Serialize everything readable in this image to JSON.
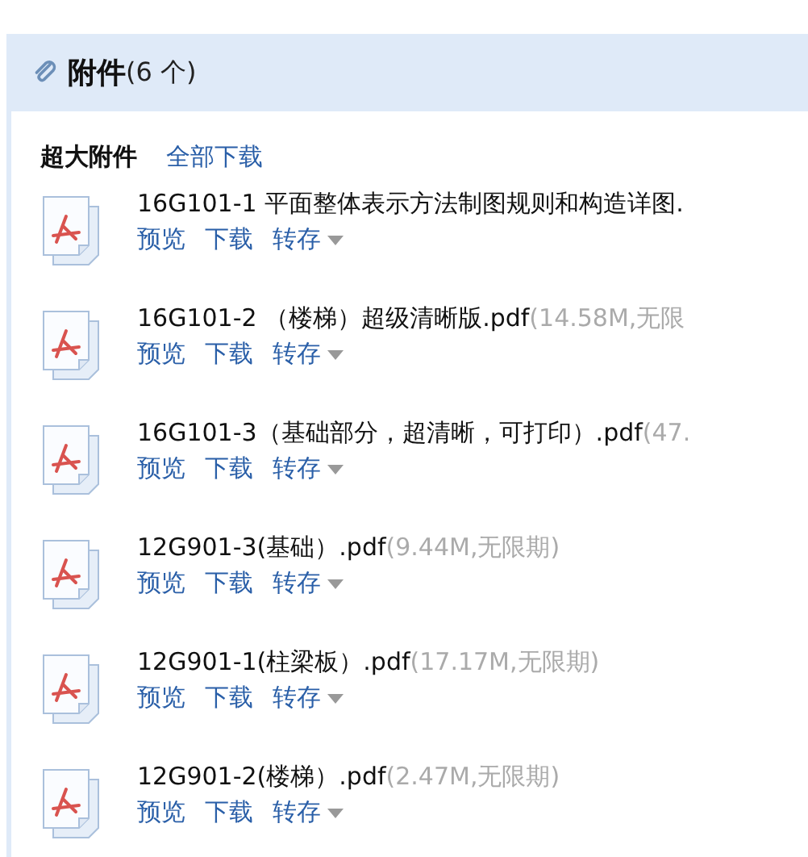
{
  "header": {
    "title": "附件",
    "count": "(6 个)"
  },
  "group": {
    "label": "超大附件",
    "download_all": "全部下载"
  },
  "files": [
    {
      "name": "16G101-1 平面整体表示方法制图规则和构造详图.",
      "actions": [
        "预览",
        "下载",
        "转存"
      ]
    },
    {
      "name": "16G101-2 （楼梯）超级清晰版.pdf",
      "size": "(14.58M,无限",
      "actions": [
        "预览",
        "下载",
        "转存"
      ]
    },
    {
      "name": "16G101-3（基础部分，超清晰，可打印）.pdf",
      "size": "(47.",
      "actions": [
        "预览",
        "下载",
        "转存"
      ]
    },
    {
      "name": "12G901-3(基础）.pdf",
      "size": "(9.44M,无限期)",
      "actions": [
        "预览",
        "下载",
        "转存"
      ]
    },
    {
      "name": "12G901-1(柱梁板）.pdf",
      "size": "(17.17M,无限期)",
      "actions": [
        "预览",
        "下载",
        "转存"
      ]
    },
    {
      "name": "12G901-2(楼梯）.pdf",
      "size": "(2.47M,无限期)",
      "actions": [
        "预览",
        "下载",
        "转存"
      ]
    }
  ]
}
